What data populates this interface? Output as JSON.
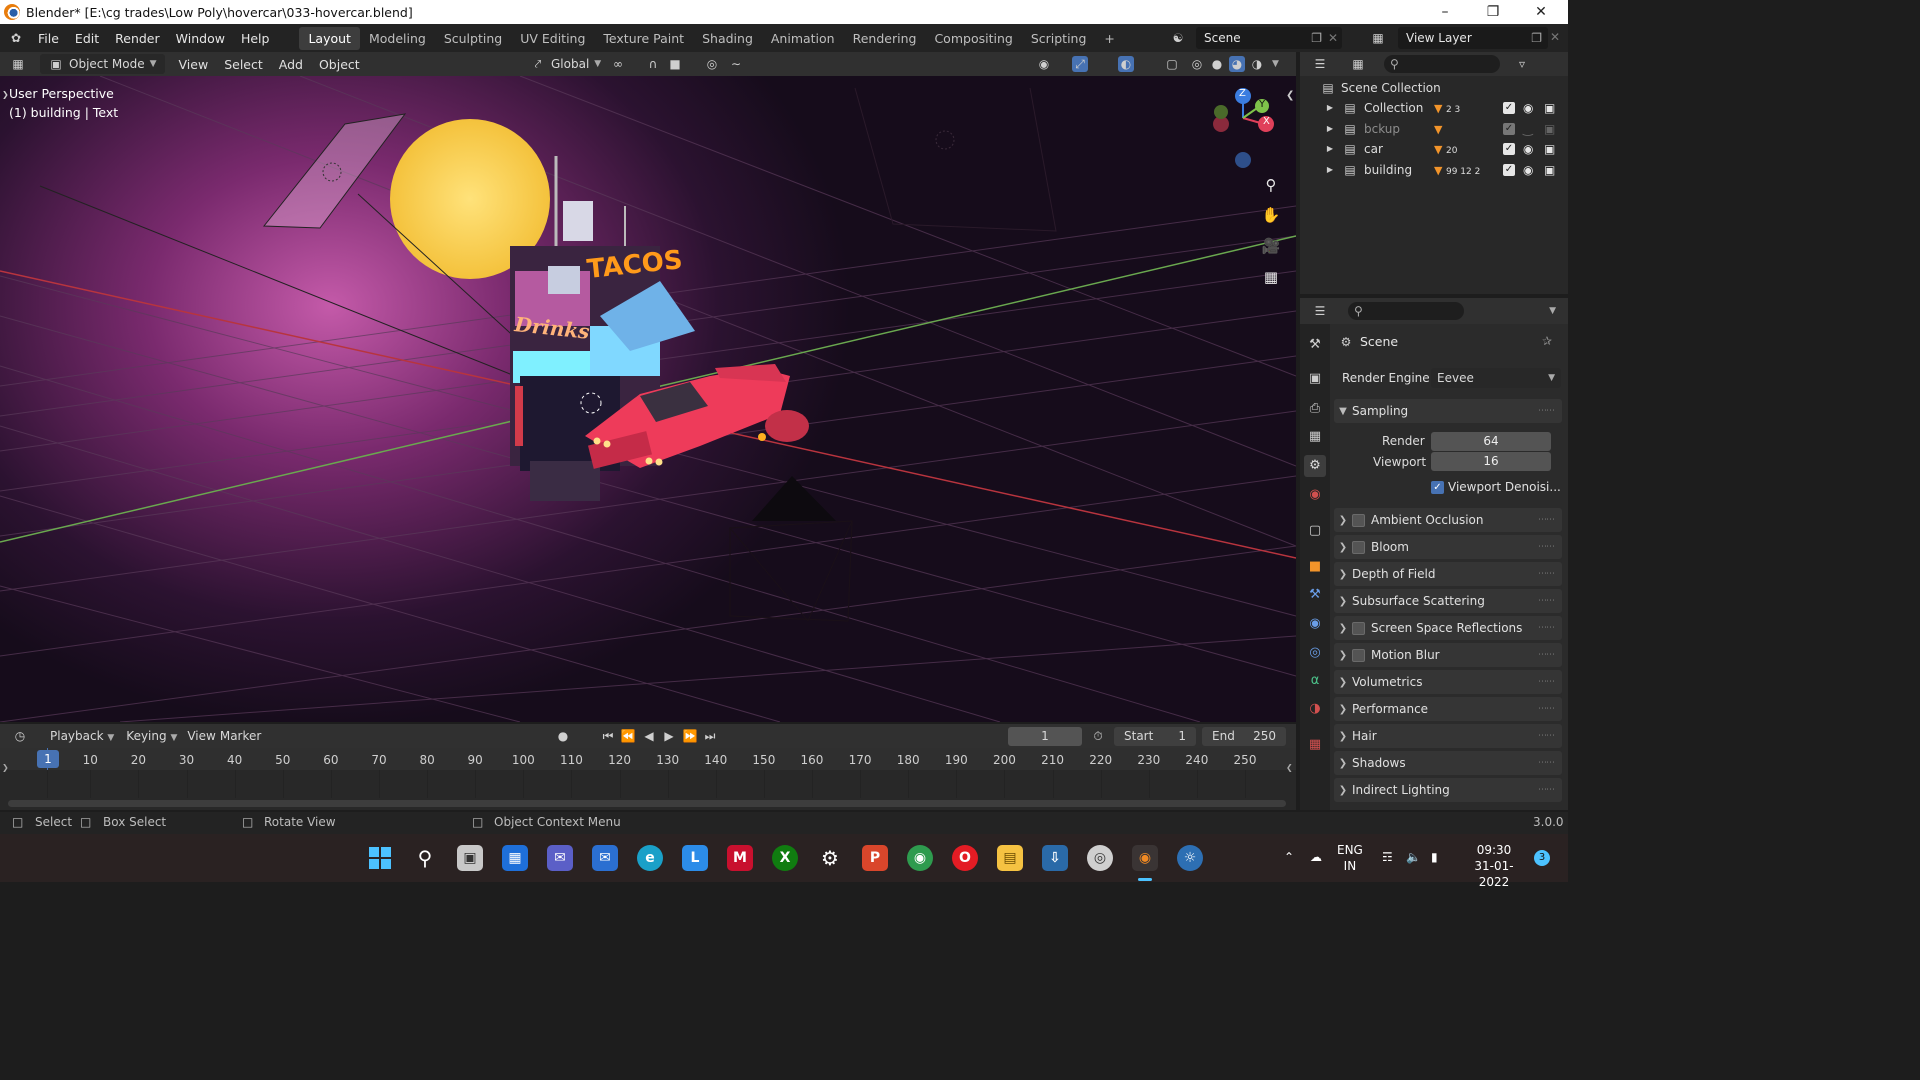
{
  "window": {
    "title": "Blender* [E:\\cg trades\\Low Poly\\hovercar\\033-hovercar.blend]"
  },
  "menu": [
    "File",
    "Edit",
    "Render",
    "Window",
    "Help"
  ],
  "workspaces": [
    "Layout",
    "Modeling",
    "Sculpting",
    "UV Editing",
    "Texture Paint",
    "Shading",
    "Animation",
    "Rendering",
    "Compositing",
    "Scripting"
  ],
  "active_workspace": "Layout",
  "scene_field": "Scene",
  "view_layer_field": "View Layer",
  "viewport_header": {
    "mode": "Object Mode",
    "menus": [
      "View",
      "Select",
      "Add",
      "Object"
    ],
    "orientation": "Global"
  },
  "viewport": {
    "perspective": "User Perspective",
    "active_object": "(1) building | Text",
    "scene_text_tacos": "TACOS",
    "scene_text_drinks": "Drinks"
  },
  "gizmo": {
    "x": "X",
    "y": "Y",
    "z": "Z"
  },
  "outliner": {
    "root": "Scene Collection",
    "collections": [
      {
        "name": "Collection",
        "dim": false,
        "badges": "2  3"
      },
      {
        "name": "bckup",
        "dim": true,
        "badges": ""
      },
      {
        "name": "car",
        "dim": false,
        "badges": "20"
      },
      {
        "name": "building",
        "dim": false,
        "badges": "99  12  2"
      }
    ]
  },
  "properties": {
    "context": "Scene",
    "render_engine_label": "Render Engine",
    "render_engine": "Eevee",
    "sampling": {
      "label": "Sampling",
      "render_label": "Render",
      "render": "64",
      "viewport_label": "Viewport",
      "viewport": "16",
      "denoise_label": "Viewport Denoisi..."
    },
    "panels": [
      {
        "label": "Ambient Occlusion",
        "checkbox": true
      },
      {
        "label": "Bloom",
        "checkbox": true
      },
      {
        "label": "Depth of Field",
        "checkbox": false
      },
      {
        "label": "Subsurface Scattering",
        "checkbox": false
      },
      {
        "label": "Screen Space Reflections",
        "checkbox": true
      },
      {
        "label": "Motion Blur",
        "checkbox": true
      },
      {
        "label": "Volumetrics",
        "checkbox": false
      },
      {
        "label": "Performance",
        "checkbox": false
      },
      {
        "label": "Hair",
        "checkbox": false
      },
      {
        "label": "Shadows",
        "checkbox": false
      },
      {
        "label": "Indirect Lighting",
        "checkbox": false
      }
    ]
  },
  "timeline": {
    "menus": [
      "Playback",
      "Keying",
      "View",
      "Marker"
    ],
    "current_frame": "1",
    "start_label": "Start",
    "start": "1",
    "end_label": "End",
    "end": "250",
    "ruler": [
      "1",
      "10",
      "20",
      "30",
      "40",
      "50",
      "60",
      "70",
      "80",
      "90",
      "100",
      "110",
      "120",
      "130",
      "140",
      "150",
      "160",
      "170",
      "180",
      "190",
      "200",
      "210",
      "220",
      "230",
      "240",
      "250"
    ]
  },
  "status_bar": {
    "select": "Select",
    "box_select": "Box Select",
    "rotate_view": "Rotate View",
    "context_menu": "Object Context Menu",
    "version": "3.0.0"
  },
  "taskbar": {
    "lang_line1": "ENG",
    "lang_line2": "IN",
    "time": "09:30",
    "date": "31-01-2022",
    "notification_count": "3"
  }
}
